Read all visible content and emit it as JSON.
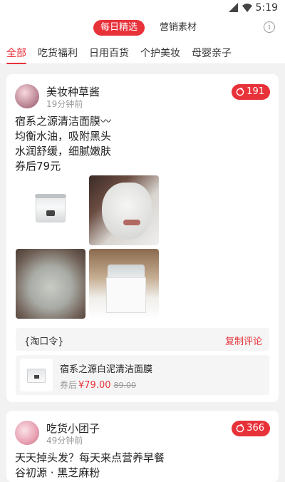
{
  "status": {
    "time": "5:19"
  },
  "topbar": {
    "seg_active": "每日精选",
    "seg_inactive": "营销素材"
  },
  "tabs": [
    "全部",
    "吃货福利",
    "日用百货",
    "个护美妆",
    "母婴亲子"
  ],
  "posts": [
    {
      "user": "美妆种草酱",
      "time": "19分钟前",
      "count": "191",
      "lines": [
        "宿系之源清洁面膜〰",
        "均衡水油，吸附黑头",
        "水润舒缓，细腻嫩肤",
        "券后79元"
      ],
      "taokou_label": "{淘口令}",
      "copy_label": "复制评论",
      "product": {
        "title": "宿系之源白泥清洁面膜",
        "coupon_label": "券后",
        "price": "¥79.00",
        "original": "89.00"
      }
    },
    {
      "user": "吃货小团子",
      "time": "49分钟前",
      "count": "366",
      "lines": [
        "天天掉头发？每天来点营养早餐",
        "谷初源 · 黑芝麻粉"
      ]
    }
  ],
  "colors": {
    "accent": "#e8323a"
  }
}
